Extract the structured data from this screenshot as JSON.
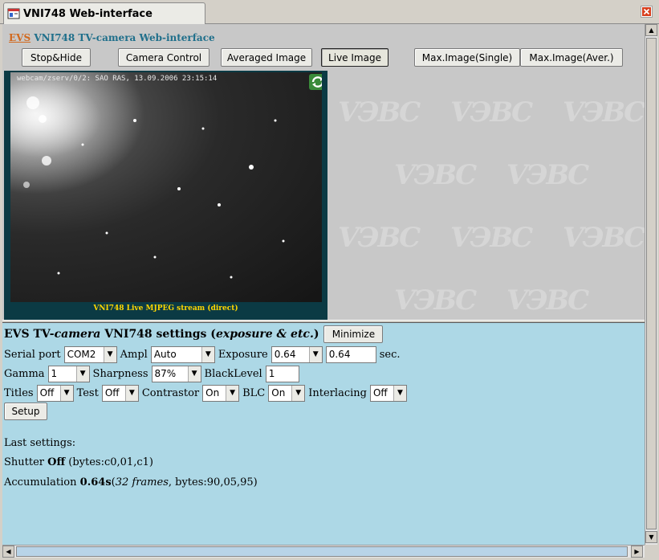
{
  "window": {
    "tab_title": "VNI748 Web-interface"
  },
  "header": {
    "link": "EVS",
    "title": "VNI748 TV-camera Web-interface"
  },
  "toolbar": {
    "buttons": [
      "Stop&Hide",
      "Camera Control",
      "Averaged Image",
      "Live Image",
      "Max.Image(Single)",
      "Max.Image(Aver.)"
    ],
    "active": "Live Image"
  },
  "camera": {
    "timestamp": "webcam/zserv/0/2: SAO RAS, 13.09.2006 23:15:14",
    "caption": "VNI748 Live MJPEG stream (direct)"
  },
  "settings": {
    "title_bold1": "EVS TV-",
    "title_italic": "camera",
    "title_bold2": " VNI748 settings (",
    "title_italic2": "exposure & etc.",
    "title_bold3": ")",
    "minimize": "Minimize",
    "serial_port_label": "Serial port",
    "serial_port": "COM2",
    "ampl_label": "Ampl",
    "ampl": "Auto",
    "exposure_label": "Exposure",
    "exposure_select": "0.64",
    "exposure_input": "0.64",
    "exposure_unit": "sec.",
    "gamma_label": "Gamma",
    "gamma": "1",
    "sharpness_label": "Sharpness",
    "sharpness": "87%",
    "blacklevel_label": "BlackLevel",
    "blacklevel": "1",
    "titles_label": "Titles",
    "titles": "Off",
    "test_label": "Test",
    "test": "Off",
    "contrastor_label": "Contrastor",
    "contrastor": "On",
    "blc_label": "BLC",
    "blc": "On",
    "interlacing_label": "Interlacing",
    "interlacing": "Off",
    "setup": "Setup"
  },
  "last": {
    "heading": "Last settings:",
    "shutter_label": "Shutter ",
    "shutter_value": "Off",
    "shutter_bytes": " (bytes:c0,01,c1)",
    "accum_label": "Accumulation ",
    "accum_value": "0.64s",
    "accum_paren_open": "(",
    "accum_frames": "32 frames",
    "accum_bytes": ", bytes:90,05,95)"
  },
  "icons": {
    "tab": "browser-window-icon",
    "close": "close-icon",
    "refresh": "refresh-icon"
  },
  "colors": {
    "settings_bg": "#add8e6",
    "evs_link": "#d2691e",
    "title": "#1f6f8b",
    "caption": "#ffd700"
  }
}
